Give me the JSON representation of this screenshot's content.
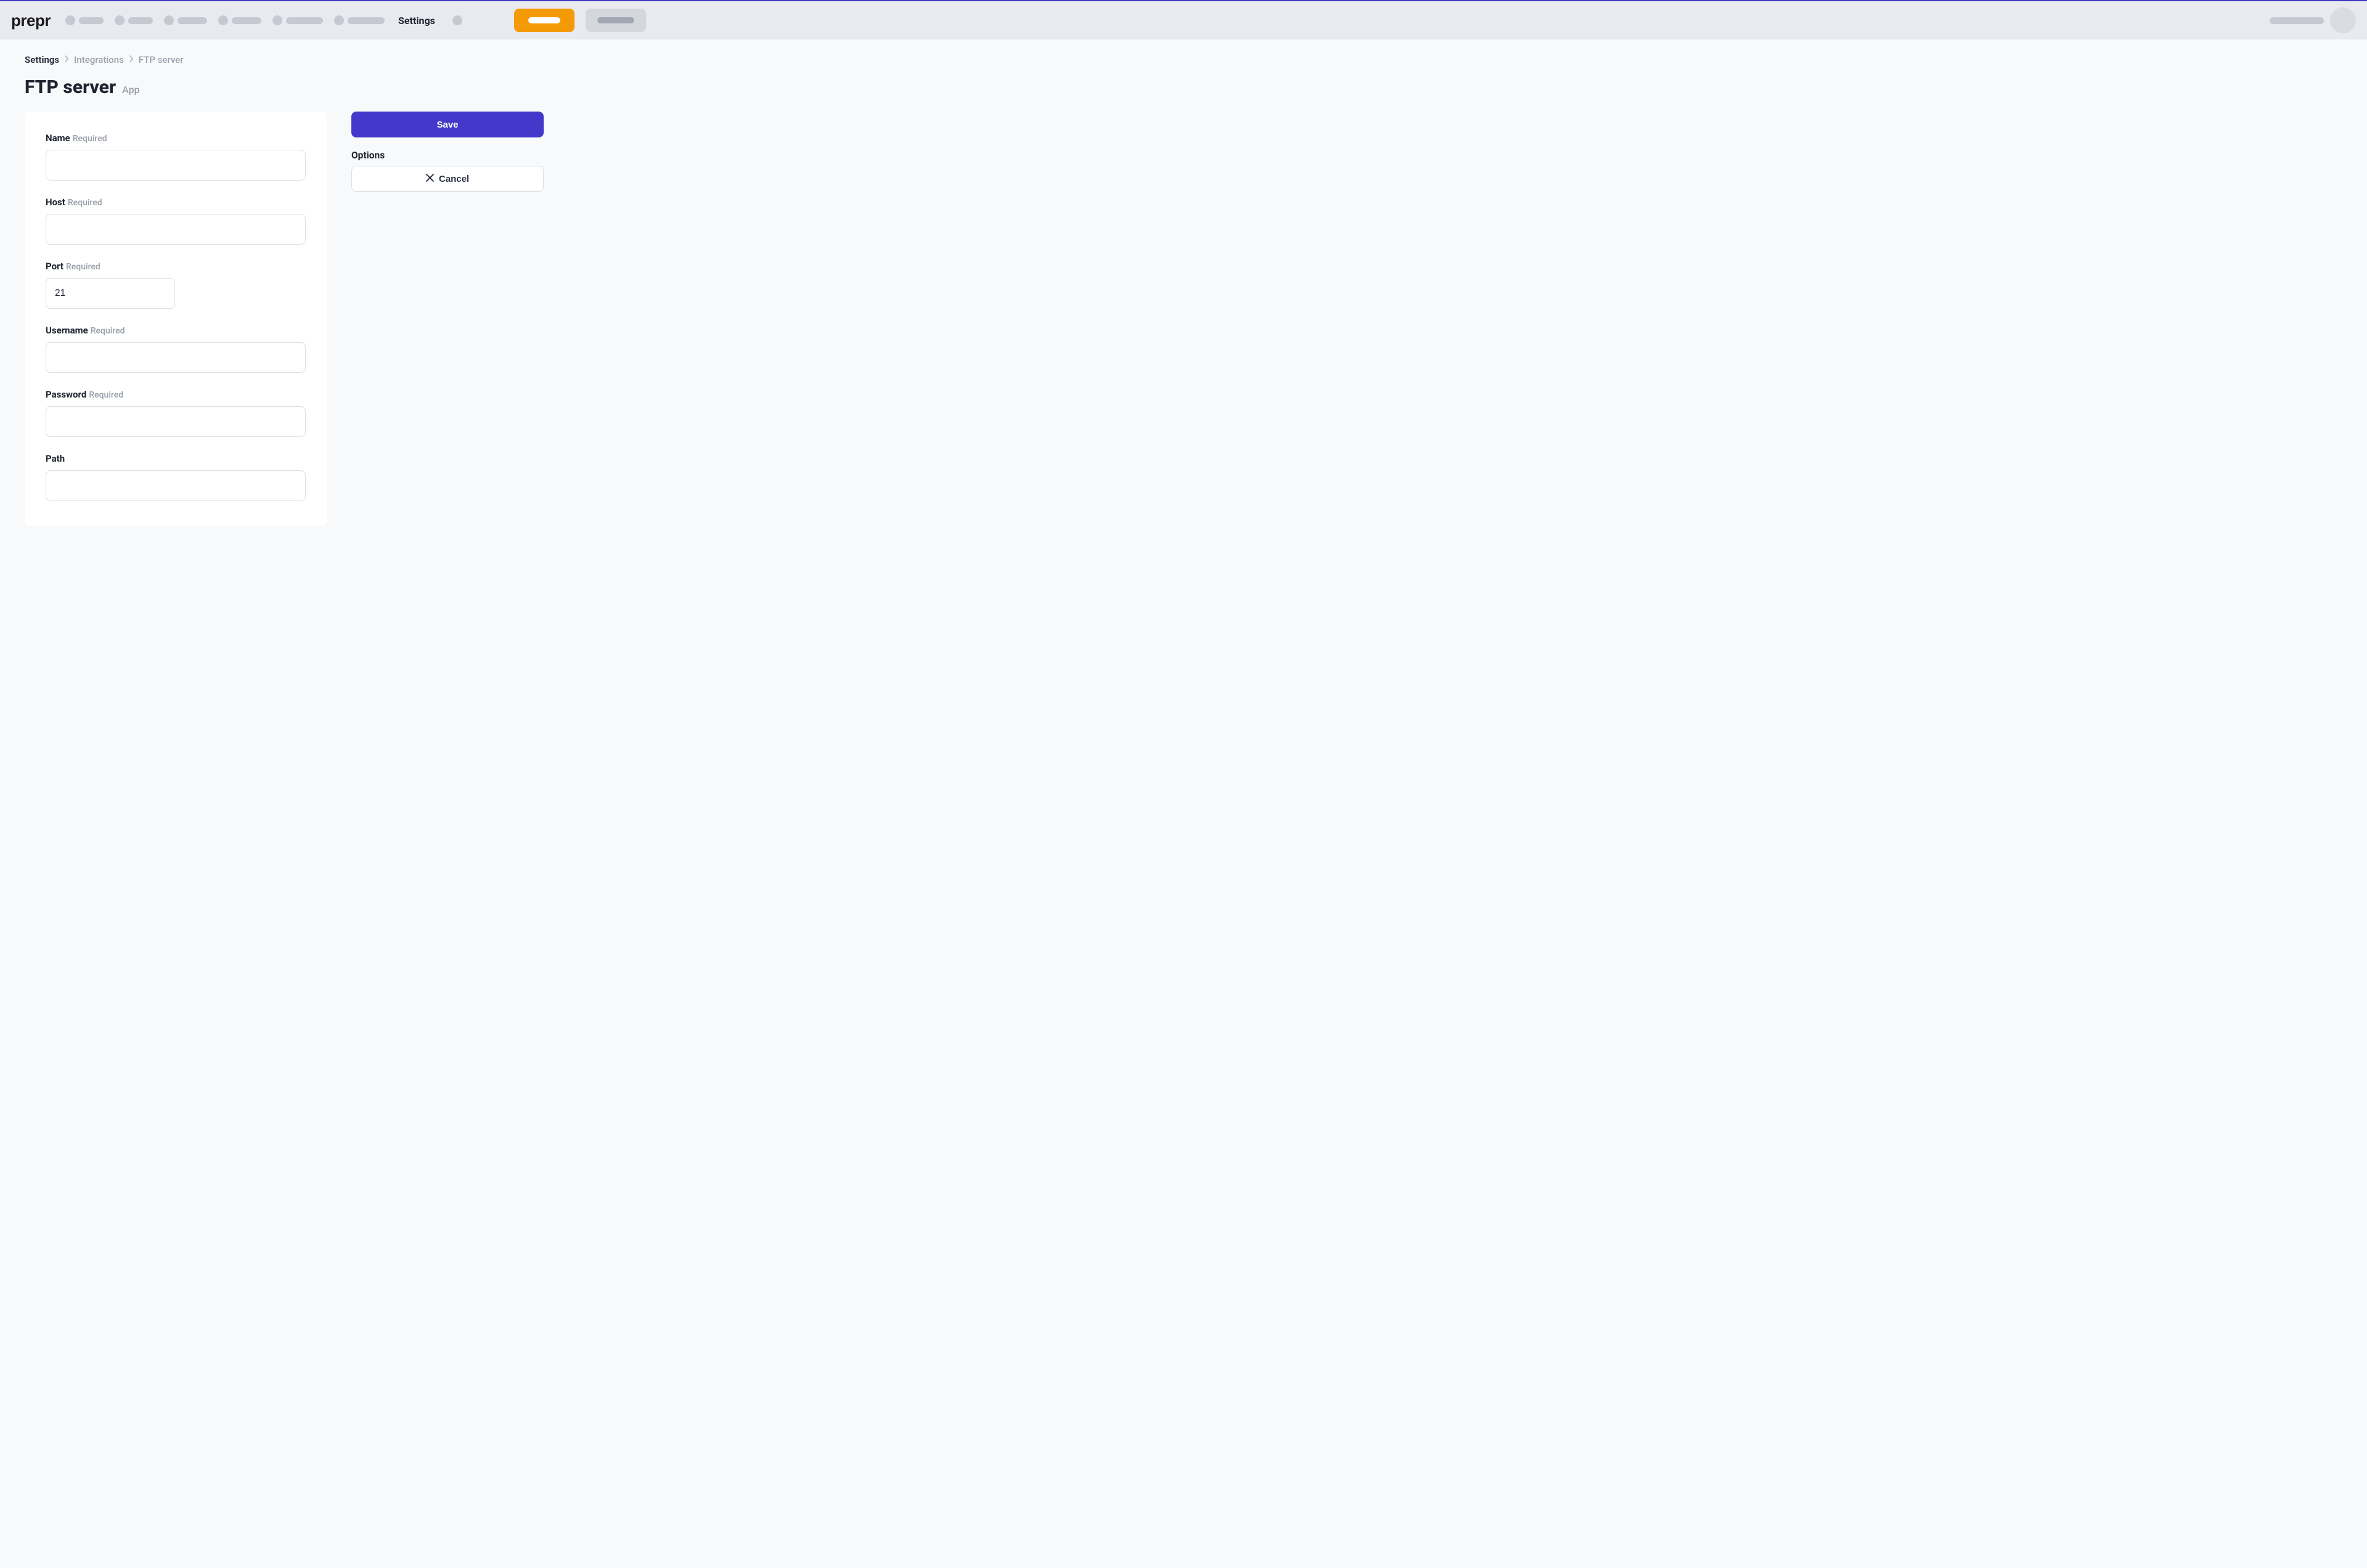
{
  "brand": "prepr",
  "nav": {
    "settings_label": "Settings"
  },
  "breadcrumb": {
    "root": "Settings",
    "mid": "Integrations",
    "leaf": "FTP server"
  },
  "page": {
    "title": "FTP server",
    "subtitle": "App"
  },
  "form": {
    "required_label": "Required",
    "name": {
      "label": "Name",
      "value": ""
    },
    "host": {
      "label": "Host",
      "value": ""
    },
    "port": {
      "label": "Port",
      "value": "21"
    },
    "username": {
      "label": "Username",
      "value": ""
    },
    "password": {
      "label": "Password",
      "value": ""
    },
    "path": {
      "label": "Path",
      "value": ""
    }
  },
  "sidebar": {
    "save_label": "Save",
    "options_heading": "Options",
    "cancel_label": "Cancel"
  }
}
